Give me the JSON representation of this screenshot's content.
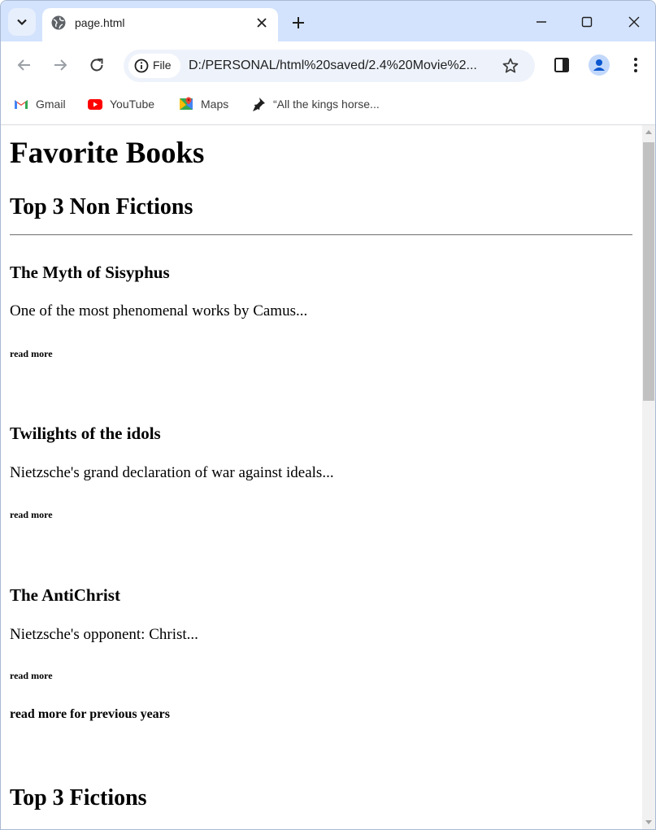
{
  "browser": {
    "tab_title": "page.html",
    "security_chip": "File",
    "url": "D:/PERSONAL/html%20saved/2.4%20Movie%2...",
    "bookmarks": [
      {
        "label": "Gmail",
        "icon": "gmail-icon"
      },
      {
        "label": "YouTube",
        "icon": "youtube-icon"
      },
      {
        "label": "Maps",
        "icon": "maps-icon"
      },
      {
        "label": "“All the kings horse...",
        "icon": "pin-icon"
      }
    ]
  },
  "page": {
    "title": "Favorite Books",
    "section1_heading": "Top 3 Non Fictions",
    "books": [
      {
        "title": "The Myth of Sisyphus",
        "desc": "One of the most phenomenal works by Camus...",
        "link": "read more"
      },
      {
        "title": "Twilights of the idols",
        "desc": "Nietzsche's grand declaration of war against ideals...",
        "link": "read more"
      },
      {
        "title": "The AntiChrist",
        "desc": "Nietzsche's opponent: Christ...",
        "link": "read more"
      }
    ],
    "previous_years_link": "read more for previous years",
    "section2_heading": "Top 3 Fictions"
  },
  "colors": {
    "tabstrip_bg": "#d3e3fd",
    "omnibox_bg": "#eef3fb",
    "avatar_fg": "#0b57d0"
  }
}
